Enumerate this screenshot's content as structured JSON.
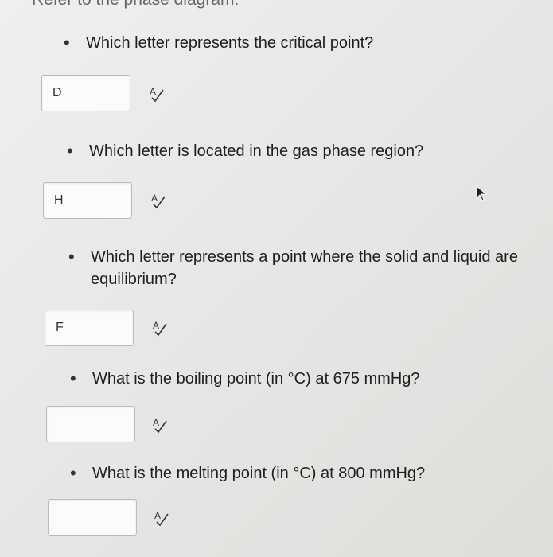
{
  "header": {
    "clipped_text": "Refer to the phase diagram:"
  },
  "questions": [
    {
      "bullet": "•",
      "text": "Which letter represents the critical point?",
      "answer": "D"
    },
    {
      "bullet": "•",
      "text": "Which letter is located in the gas phase region?",
      "answer": "H"
    },
    {
      "bullet": "•",
      "text_line1": "Which letter represents a point where the solid and liquid are",
      "text_line2": "equilibrium?",
      "answer": "F"
    },
    {
      "bullet": "•",
      "text": "What is the boiling point (in °C) at 675 mmHg?",
      "answer": ""
    },
    {
      "bullet": "•",
      "text": "What is the melting point (in °C) at 800 mmHg?",
      "answer": ""
    }
  ],
  "icons": {
    "spell_check": "spell-check-icon",
    "cursor": "mouse-pointer-icon"
  },
  "colors": {
    "background": "#e6e8e6",
    "box_border": "#b9bcb9",
    "text": "#1f1f1f"
  }
}
